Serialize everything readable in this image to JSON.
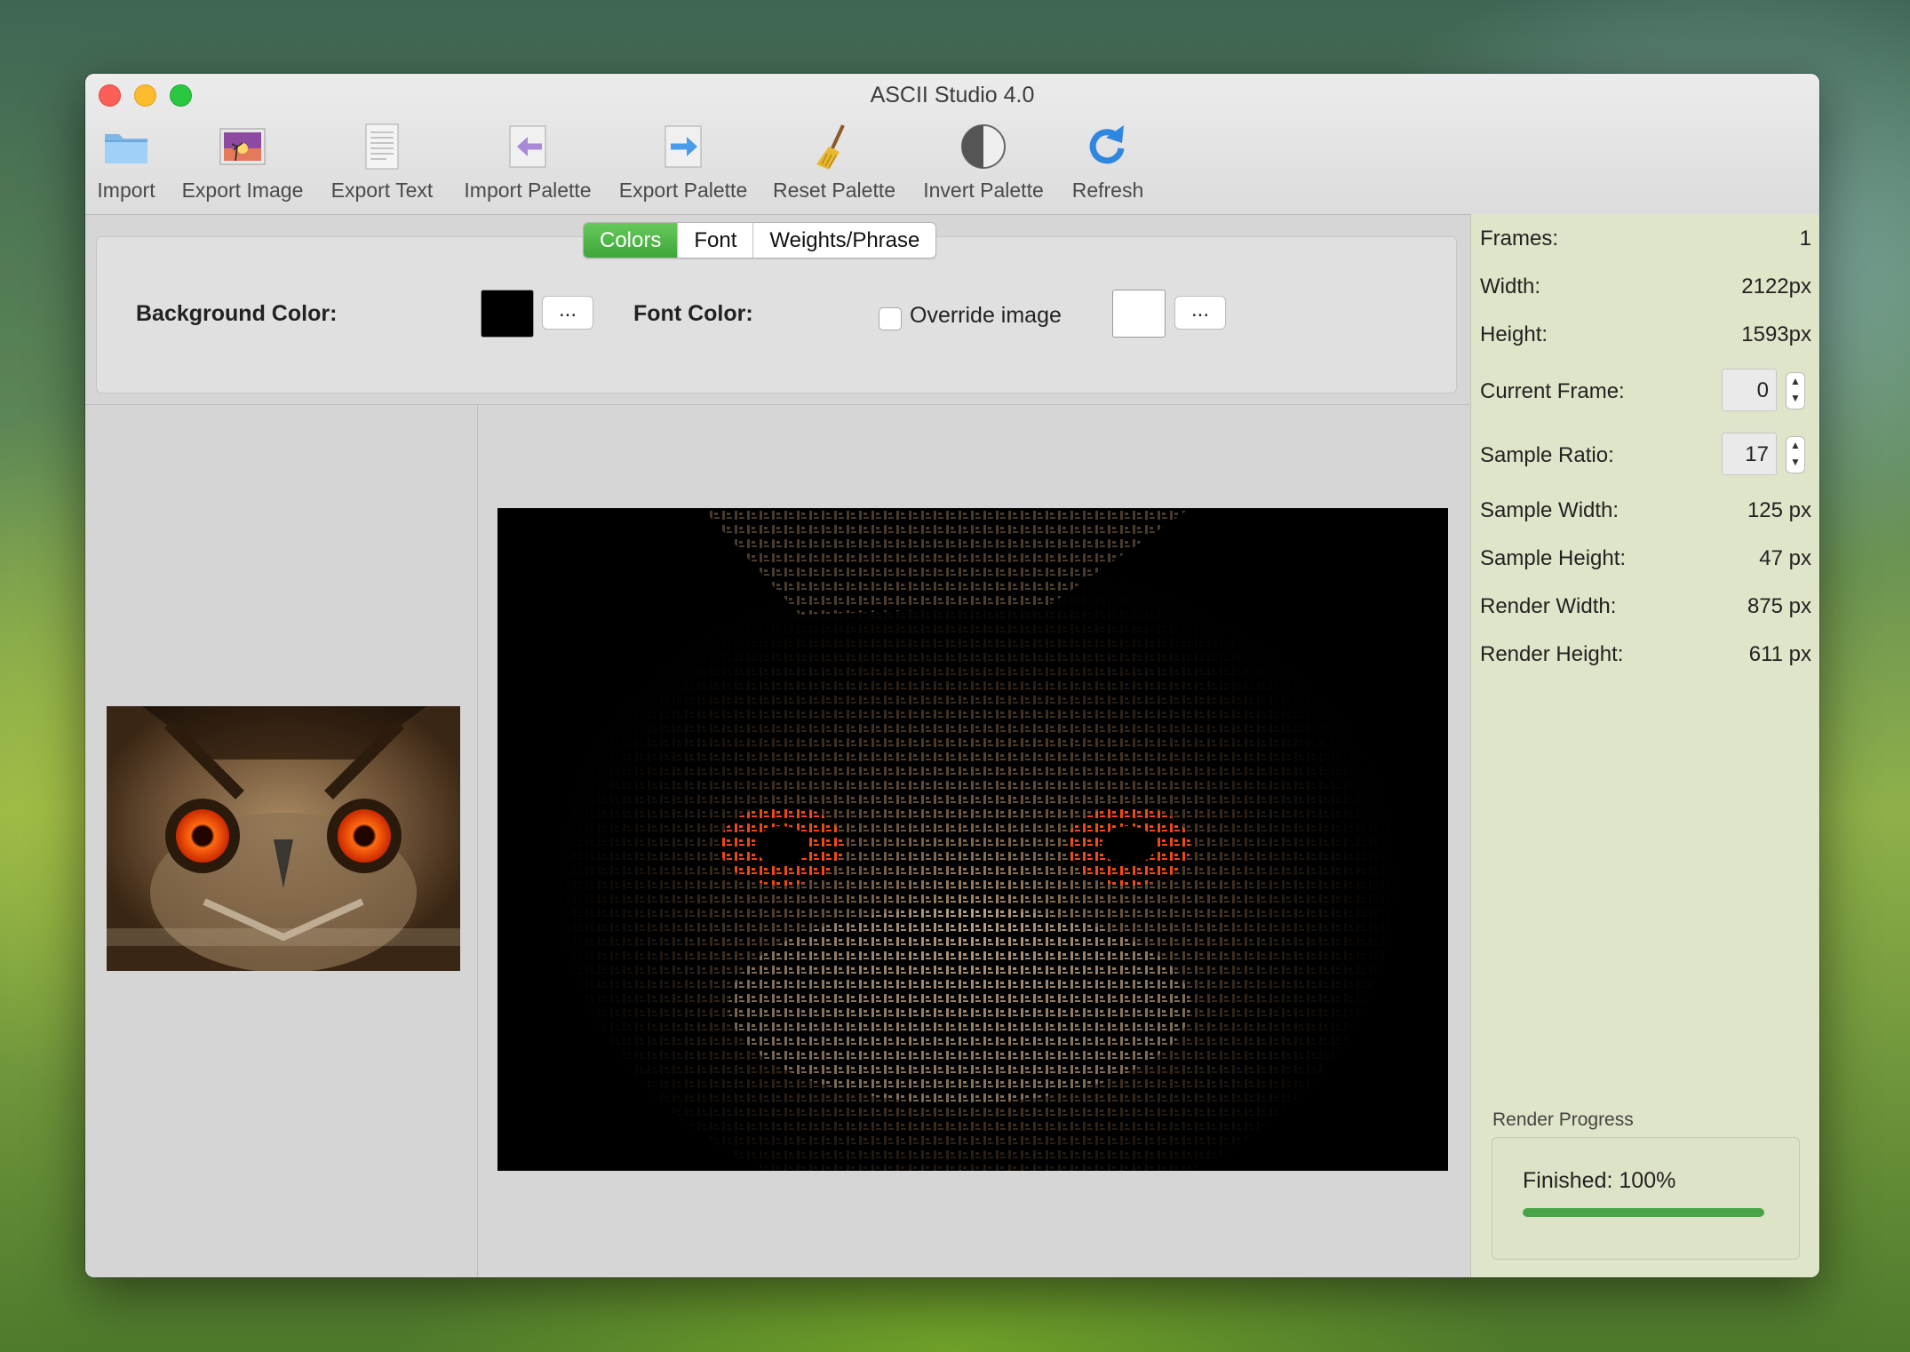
{
  "window": {
    "title": "ASCII Studio 4.0"
  },
  "toolbar": {
    "items": [
      {
        "label": "Import",
        "icon": "folder-icon"
      },
      {
        "label": "Export Image",
        "icon": "image-icon"
      },
      {
        "label": "Export Text",
        "icon": "text-document-icon"
      },
      {
        "label": "Import Palette",
        "icon": "import-arrow-icon"
      },
      {
        "label": "Export Palette",
        "icon": "export-arrow-icon"
      },
      {
        "label": "Reset Palette",
        "icon": "broom-icon"
      },
      {
        "label": "Invert Palette",
        "icon": "half-circle-icon"
      },
      {
        "label": "Refresh",
        "icon": "refresh-icon"
      }
    ]
  },
  "tabs": [
    {
      "label": "Colors",
      "active": true
    },
    {
      "label": "Font",
      "active": false
    },
    {
      "label": "Weights/Phrase",
      "active": false
    }
  ],
  "colors": {
    "background_label": "Background Color:",
    "background_value": "#000000",
    "browse_label": "...",
    "font_label": "Font Color:",
    "override_label": "Override image",
    "override_checked": false,
    "font_value": "#ffffff"
  },
  "info": {
    "frames_label": "Frames:",
    "frames_value": "1",
    "width_label": "Width:",
    "width_value": "2122px",
    "height_label": "Height:",
    "height_value": "1593px",
    "current_frame_label": "Current Frame:",
    "current_frame_value": "0",
    "sample_ratio_label": "Sample Ratio:",
    "sample_ratio_value": "17",
    "sample_width_label": "Sample Width:",
    "sample_width_value": "125 px",
    "sample_height_label": "Sample Height:",
    "sample_height_value": "47 px",
    "render_width_label": "Render Width:",
    "render_width_value": "875 px",
    "render_height_label": "Render Height:",
    "render_height_value": "611 px"
  },
  "progress": {
    "title": "Render Progress",
    "status": "Finished: 100%",
    "fraction": 1.0,
    "color": "#47a548"
  },
  "accent": "#4cb546"
}
